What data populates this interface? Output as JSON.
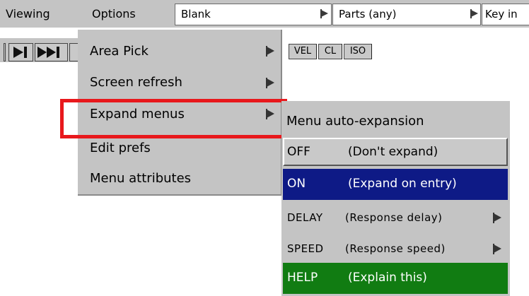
{
  "menubar": {
    "viewing": "Viewing",
    "options": "Options",
    "field_blank": "Blank",
    "field_parts": "Parts (any)",
    "field_key": "Key in"
  },
  "toolbar": {
    "buttons": [
      "VEL",
      "CL",
      "ISO"
    ]
  },
  "options_menu": {
    "items": [
      {
        "label": "Area Pick",
        "has_submenu": true
      },
      {
        "label": "Screen refresh",
        "has_submenu": true
      },
      {
        "label": "Expand menus",
        "has_submenu": true,
        "highlighted": true
      },
      {
        "label": "Edit prefs",
        "has_submenu": false
      },
      {
        "label": "Menu attributes",
        "has_submenu": false
      }
    ]
  },
  "expand_submenu": {
    "title": "Menu auto-expansion",
    "off": {
      "key": "OFF",
      "desc": "(Don't expand)"
    },
    "on": {
      "key": "ON",
      "desc": "(Expand on entry)"
    },
    "delay": {
      "key": "DELAY",
      "desc": "(Response delay)"
    },
    "speed": {
      "key": "SPEED",
      "desc": "(Response speed)"
    },
    "help": {
      "key": "HELP",
      "desc": "(Explain this)"
    }
  },
  "colors": {
    "menu_bg": "#c4c4c4",
    "selected_bg": "#0e1a86",
    "help_bg": "#117c12",
    "highlight_border": "#e8181c"
  },
  "icons": [
    "dropdown-flag-icon",
    "submenu-arrow-icon",
    "step-end-icon",
    "fast-forward-icon"
  ]
}
